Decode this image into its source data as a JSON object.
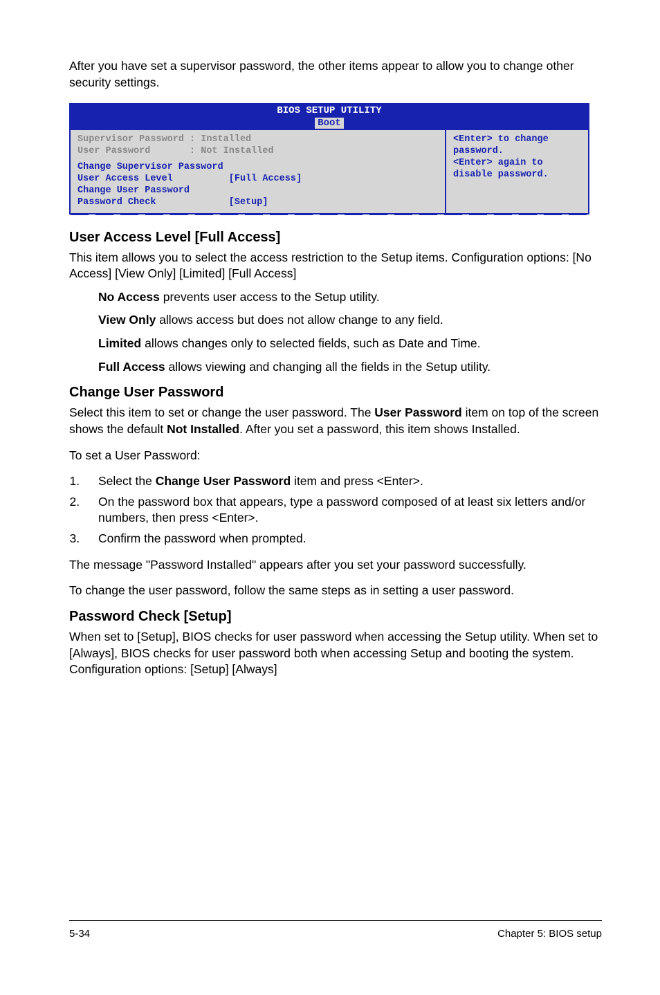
{
  "intro": "After you have set a supervisor password, the other items appear to allow you to change other security settings.",
  "bios": {
    "title": "BIOS SETUP UTILITY",
    "tab": "Boot",
    "left": {
      "l1a": "Supervisor Password : Installed",
      "l2a": "User Password       : Not Installed",
      "l3": "Change Supervisor Password",
      "l4a": "User Access Level",
      "l4b": "[Full Access]",
      "l5": "Change User Password",
      "l6a": "Password Check",
      "l6b": "[Setup]"
    },
    "right": {
      "t1": "<Enter> to change",
      "t2": "password.",
      "t3": "<Enter> again to",
      "t4": "disable password."
    }
  },
  "ual": {
    "heading": "User Access Level [Full Access]",
    "p1": "This item allows you to select the access restriction to the Setup items. Configuration options: [No Access] [View Only] [Limited] [Full Access]",
    "na_b": "No Access",
    "na_t": " prevents user access to the Setup utility.",
    "vo_b": "View Only",
    "vo_t": " allows access but does not allow change to any field.",
    "lm_b": "Limited",
    "lm_t": " allows changes only to selected fields, such as Date and Time.",
    "fa_b": "Full Access",
    "fa_t": " allows viewing and changing all the fields in the Setup utility."
  },
  "cup": {
    "heading": "Change User Password",
    "p1a": "Select this item to set or change the user password. The ",
    "p1b": "User Password",
    "p1c": " item on top of the screen shows the default ",
    "p1d": "Not Installed",
    "p1e": ". After you set a password, this item shows Installed.",
    "p2": "To set a User Password:",
    "li1a": "Select the ",
    "li1b": "Change User Password",
    "li1c": " item and press <Enter>.",
    "li2": "On the password box that appears, type a password composed of at least six letters and/or numbers, then press <Enter>.",
    "li3": "Confirm the password when prompted.",
    "p3": "The message \"Password Installed\" appears after you set your password successfully.",
    "p4": "To change the user password, follow the same steps as in setting a user password."
  },
  "pc": {
    "heading": "Password Check [Setup]",
    "p1": "When set to [Setup], BIOS checks for user password when accessing the Setup utility. When set to [Always], BIOS checks for user password both when accessing Setup and booting the system. Configuration options: [Setup] [Always]"
  },
  "footer": {
    "left": "5-34",
    "right": "Chapter 5: BIOS setup"
  }
}
